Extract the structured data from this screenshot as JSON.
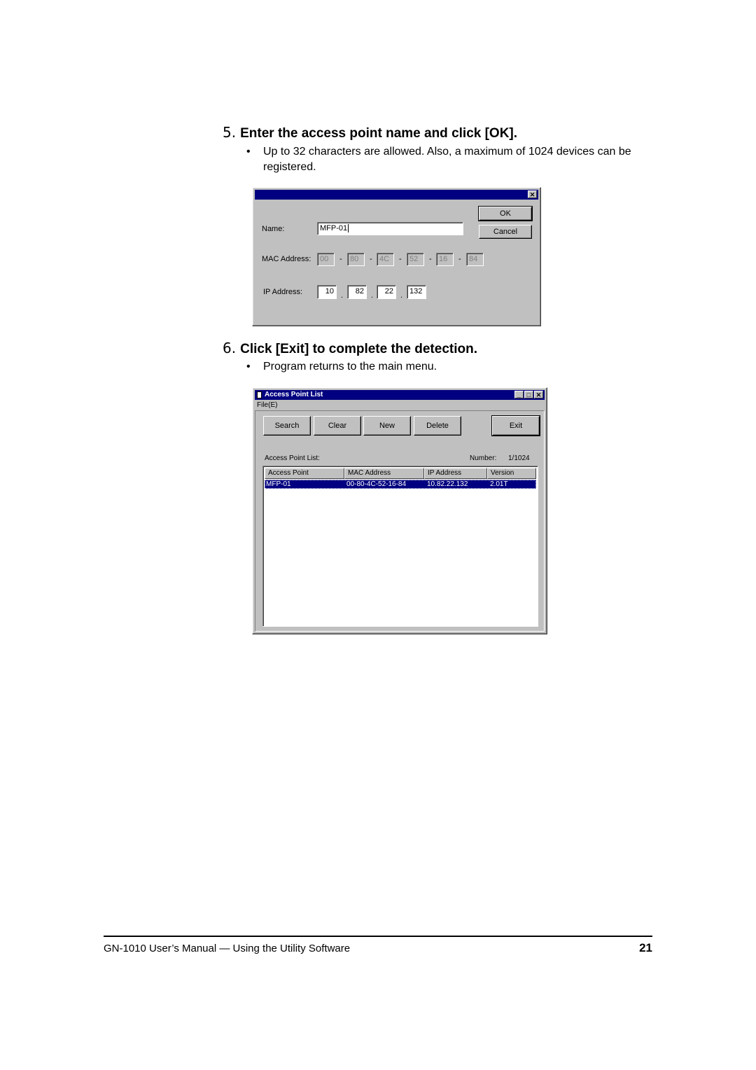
{
  "steps": [
    {
      "number": "5.",
      "title": "Enter the access point name and click [OK].",
      "bullets": [
        "Up to 32 characters are allowed.  Also, a maximum of 1024 devices can be registered."
      ]
    },
    {
      "number": "6.",
      "title": "Click [Exit] to complete the detection.",
      "bullets": [
        "Program returns to the main menu."
      ]
    }
  ],
  "bullet_glyph": "•",
  "dialog": {
    "close_glyph": "✕",
    "ok_label": "OK",
    "cancel_label": "Cancel",
    "name_label": "Name:",
    "name_value": "MFP-01",
    "mac_label": "MAC Address:",
    "mac_octets": [
      "00",
      "80",
      "4C",
      "52",
      "16",
      "84"
    ],
    "mac_separator": "-",
    "ip_label": "IP Address:",
    "ip_octets": [
      "10",
      "82",
      "22",
      "132"
    ],
    "ip_separator": "."
  },
  "ap_window": {
    "title": "Access Point List",
    "menu": [
      "File(E)"
    ],
    "buttons": {
      "search": "Search",
      "clear": "Clear",
      "new": "New",
      "delete": "Delete",
      "exit": "Exit"
    },
    "list_label": "Access Point List:",
    "number_label": "Number:",
    "number_value": "1/1024",
    "columns": [
      "Access Point",
      "MAC Address",
      "IP Address",
      "Version"
    ],
    "rows": [
      [
        "MFP-01",
        "00-80-4C-52-16-84",
        "10.82.22.132",
        "2.01T"
      ]
    ],
    "minimize_glyph": "_",
    "maximize_glyph": "□",
    "close_glyph": "✕"
  },
  "footer": {
    "text": "GN-1010 User’s Manual — Using the Utility Software",
    "page": "21"
  }
}
